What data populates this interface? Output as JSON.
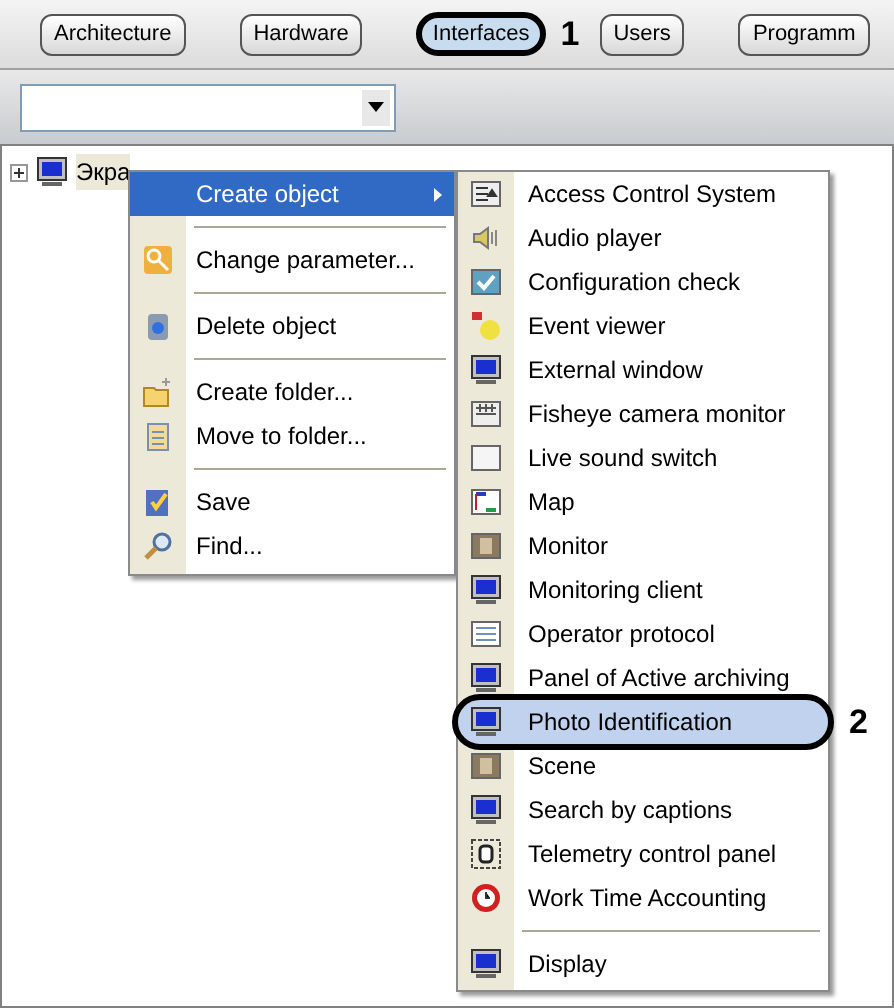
{
  "tabs": [
    {
      "label": "Architecture",
      "selected": false
    },
    {
      "label": "Hardware",
      "selected": false
    },
    {
      "label": "Interfaces",
      "selected": true,
      "callout": "1"
    },
    {
      "label": "Users",
      "selected": false
    },
    {
      "label": "Programm",
      "selected": false
    }
  ],
  "tree": {
    "items": [
      {
        "label": "Экра",
        "expanded": false
      }
    ]
  },
  "context_menu": {
    "groups": [
      [
        {
          "label": "Create object",
          "submenu": true,
          "selected": true
        }
      ],
      [
        {
          "label": "Change parameter...",
          "submenu": false,
          "selected": false
        }
      ],
      [
        {
          "label": "Delete object",
          "submenu": false,
          "selected": false
        }
      ],
      [
        {
          "label": "Create folder...",
          "submenu": false,
          "selected": false
        },
        {
          "label": "Move to folder...",
          "submenu": false,
          "selected": false
        }
      ],
      [
        {
          "label": "Save",
          "submenu": false,
          "selected": false
        },
        {
          "label": "Find...",
          "submenu": false,
          "selected": false
        }
      ]
    ]
  },
  "submenu": {
    "groups": [
      [
        {
          "label": "Access Control System",
          "selected": false
        },
        {
          "label": "Audio player",
          "selected": false
        },
        {
          "label": "Configuration check",
          "selected": false
        },
        {
          "label": "Event viewer",
          "selected": false
        },
        {
          "label": "External window",
          "selected": false
        },
        {
          "label": "Fisheye camera monitor",
          "selected": false
        },
        {
          "label": "Live sound switch",
          "selected": false
        },
        {
          "label": "Map",
          "selected": false
        },
        {
          "label": "Monitor",
          "selected": false
        },
        {
          "label": "Monitoring client",
          "selected": false
        },
        {
          "label": "Operator protocol",
          "selected": false
        },
        {
          "label": "Panel of Active archiving",
          "selected": false
        },
        {
          "label": "Photo Identification",
          "selected": true,
          "callout": "2"
        },
        {
          "label": "Scene",
          "selected": false
        },
        {
          "label": "Search by captions",
          "selected": false
        },
        {
          "label": "Telemetry control panel",
          "selected": false
        },
        {
          "label": "Work Time Accounting",
          "selected": false
        }
      ],
      [
        {
          "label": "Display",
          "selected": false
        }
      ]
    ]
  }
}
